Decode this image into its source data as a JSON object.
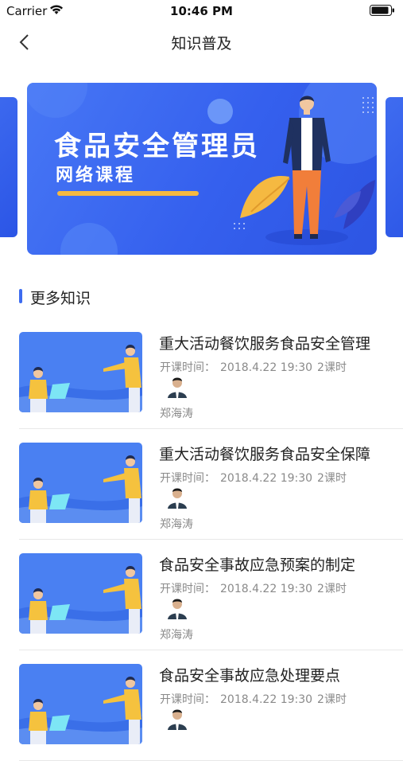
{
  "status_bar": {
    "carrier": "Carrier",
    "time": "10:46 PM"
  },
  "nav": {
    "title": "知识普及",
    "back_icon": "chevron-left-icon"
  },
  "banner": {
    "title": "食品安全管理员",
    "subtitle": "网络课程",
    "colors": {
      "background": "#3d6cf0",
      "accent": "#f5b941"
    }
  },
  "section": {
    "title": "更多知识"
  },
  "courses": [
    {
      "title": "重大活动餐饮服务食品安全管理",
      "time_label": "开课时间：",
      "time": "2018.4.22 19:30",
      "hours": "2课时",
      "teacher": "郑海涛"
    },
    {
      "title": "重大活动餐饮服务食品安全保障",
      "time_label": "开课时间：",
      "time": "2018.4.22 19:30",
      "hours": "2课时",
      "teacher": "郑海涛"
    },
    {
      "title": "食品安全事故应急预案的制定",
      "time_label": "开课时间：",
      "time": "2018.4.22 19:30",
      "hours": "2课时",
      "teacher": "郑海涛"
    },
    {
      "title": "食品安全事故应急处理要点",
      "time_label": "开课时间：",
      "time": "2018.4.22 19:30",
      "hours": "2课时",
      "teacher": ""
    }
  ]
}
